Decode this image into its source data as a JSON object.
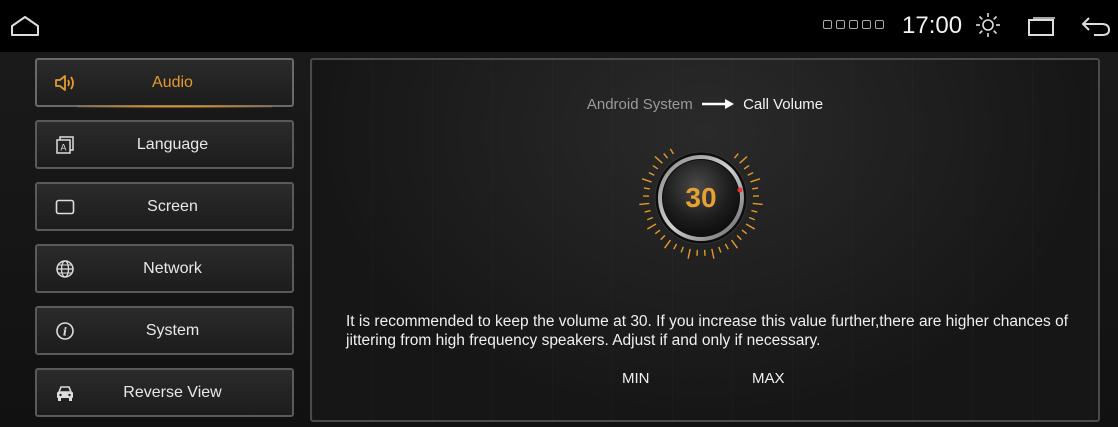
{
  "status_bar": {
    "time": "17:00"
  },
  "menu": {
    "items": [
      {
        "label": "Audio",
        "icon": "speaker-icon",
        "active": true
      },
      {
        "label": "Language",
        "icon": "language-icon",
        "active": false
      },
      {
        "label": "Screen",
        "icon": "screen-icon",
        "active": false
      },
      {
        "label": "Network",
        "icon": "globe-icon",
        "active": false
      },
      {
        "label": "System",
        "icon": "info-icon",
        "active": false
      },
      {
        "label": "Reverse View",
        "icon": "car-icon",
        "active": false
      }
    ]
  },
  "panel": {
    "breadcrumb_parent": "Android System",
    "breadcrumb_current": "Call Volume",
    "volume_value": "30",
    "note": "It is recommended to keep the volume at 30. If you increase this value further,there are higher chances of jittering from high frequency speakers. Adjust if and only if necessary.",
    "min_label": "MIN",
    "max_label": "MAX"
  },
  "colors": {
    "accent": "#e39a2a",
    "background": "#000000"
  }
}
